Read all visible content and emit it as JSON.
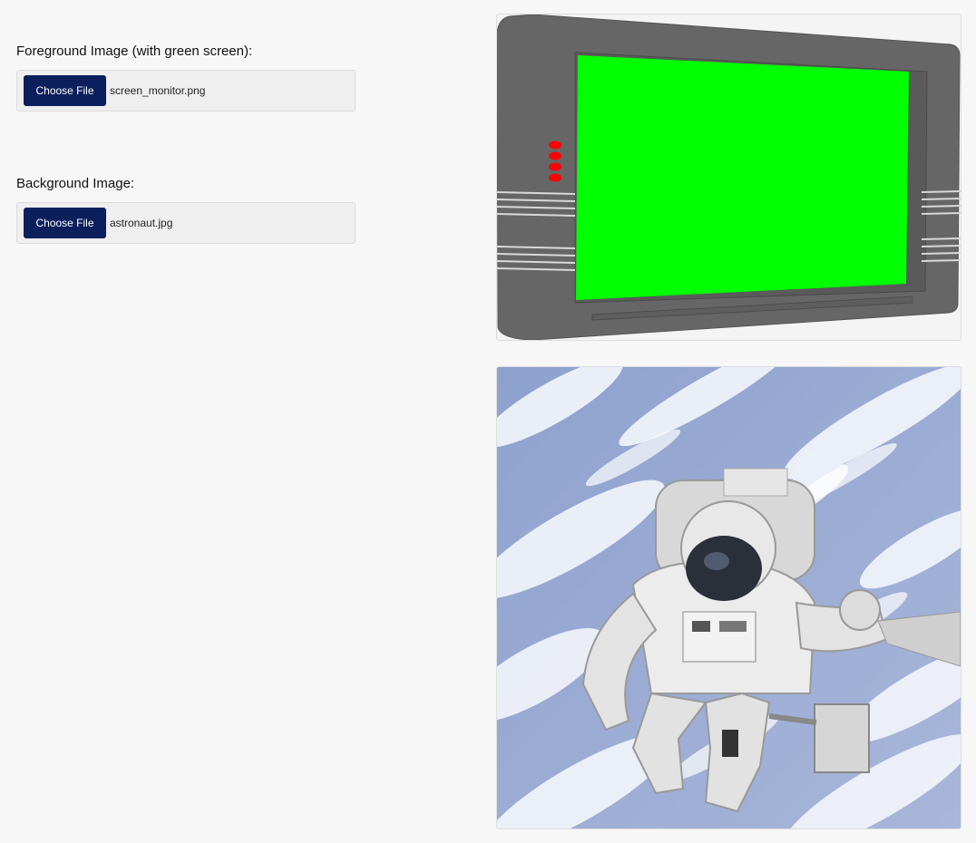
{
  "foreground": {
    "label": "Foreground Image (with green screen):",
    "button_label": "Choose File",
    "file_name": "screen_monitor.png"
  },
  "background": {
    "label": "Background Image:",
    "button_label": "Choose File",
    "file_name": "astronaut.jpg"
  },
  "colors": {
    "button_bg": "#0a1f5c",
    "green_screen": "#00ff00",
    "monitor_body": "#666666",
    "indicator_lights": "#ff0000"
  }
}
